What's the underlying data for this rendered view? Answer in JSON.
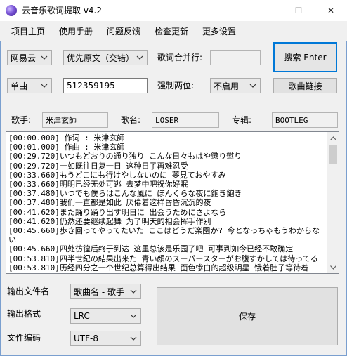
{
  "window": {
    "title": "云音乐歌词提取 v4.2",
    "minimize_glyph": "—",
    "maximize_glyph": "☐",
    "close_glyph": "✕"
  },
  "menu": [
    "项目主页",
    "使用手册",
    "问题反馈",
    "检查更新",
    "更多设置"
  ],
  "row1": {
    "source": "网易云",
    "priority": "优先原文（交错）",
    "merge_label": "歌词合并行:",
    "merge_value": "",
    "search_button": "搜索 Enter"
  },
  "row2": {
    "mode": "单曲",
    "id_value": "512359195",
    "force_digits_label": "强制两位:",
    "force_digits_value": "不启用",
    "link_button": "歌曲链接"
  },
  "info": {
    "singer_label": "歌手:",
    "singer_value": "米津玄師",
    "song_label": "歌名:",
    "song_value": "LOSER",
    "album_label": "专辑:",
    "album_value": "BOOTLEG"
  },
  "lyrics": [
    "[00:00.000] 作词 : 米津玄師",
    "[00:01.000] 作曲 : 米津玄師",
    "[00:29.720]いつもどおりの通り独り こんな日々もはや懲り懲り",
    "[00:29.720]一如既往日复一日 这种日子再难忍受",
    "[00:33.660]もうどこにも行けやしないのに 夢見ておやすみ",
    "[00:33.660]明明已经无处可逃 去梦中吧祝你好眠",
    "[00:37.480]いつでも僕らはこんな風に ぼんくらな夜に飽き飽き",
    "[00:37.480]我们一直都是如此 厌倦着这样昏昏沉沉的夜",
    "[00:41.620]また踊り踊り出す明日に 出会うためにさよなら",
    "[00:41.620]仍然还要继续起舞 为了明天的相会挥手作别",
    "[00:45.660]歩き回ってやってたいた ここはどうだ楽園か? 今となっちゃもうわからない",
    "[00:45.660]四处彷徨后终于到达 这里总该是乐园了吧 可事到如今已经不敢确定",
    "[00:53.810]四半世紀の結果出来た 青い顔のスーパースターがお腹すかしては待ってる",
    "[00:53.810]历经四分之一个世纪总算得出结果 面色惨白的超级明星 饿着肚子等待着"
  ],
  "output": {
    "filename_label": "输出文件名",
    "filename_value": "歌曲名 - 歌手",
    "format_label": "输出格式",
    "format_value": "LRC",
    "encoding_label": "文件编码",
    "encoding_value": "UTF-8",
    "save_button": "保存"
  },
  "icons": {
    "app": "app-logo-icon",
    "dropdown": "chevron-down-icon"
  },
  "colors": {
    "accent": "#0078d7",
    "window_border": "#7a9fcf",
    "background": "#f0f0f0"
  }
}
